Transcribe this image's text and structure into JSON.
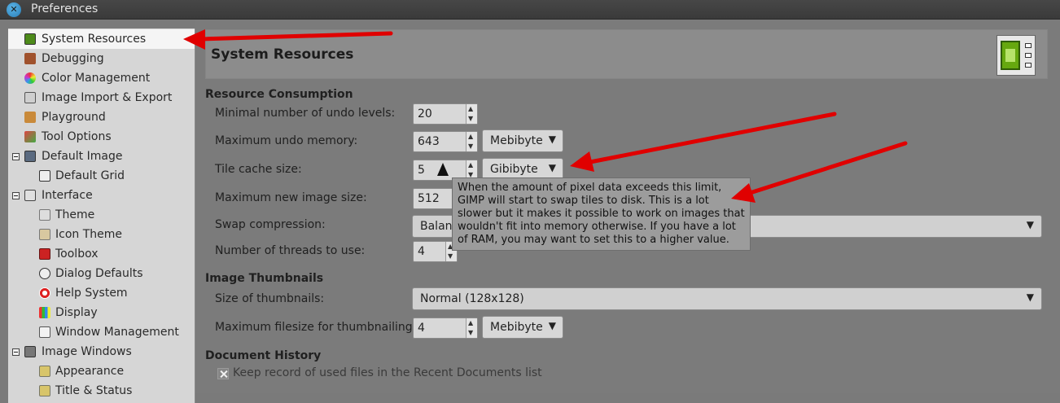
{
  "window": {
    "title": "Preferences"
  },
  "sidebar": {
    "items": [
      {
        "label": "System Resources"
      },
      {
        "label": "Debugging"
      },
      {
        "label": "Color Management"
      },
      {
        "label": "Image Import & Export"
      },
      {
        "label": "Playground"
      },
      {
        "label": "Tool Options"
      },
      {
        "label": "Default Image"
      },
      {
        "label": "Default Grid"
      },
      {
        "label": "Interface"
      },
      {
        "label": "Theme"
      },
      {
        "label": "Icon Theme"
      },
      {
        "label": "Toolbox"
      },
      {
        "label": "Dialog Defaults"
      },
      {
        "label": "Help System"
      },
      {
        "label": "Display"
      },
      {
        "label": "Window Management"
      },
      {
        "label": "Image Windows"
      },
      {
        "label": "Appearance"
      },
      {
        "label": "Title & Status"
      }
    ]
  },
  "page": {
    "title": "System Resources"
  },
  "resource": {
    "section_title": "Resource Consumption",
    "undo_levels": {
      "label": "Minimal number of undo levels:",
      "value": "20"
    },
    "undo_memory": {
      "label": "Maximum undo memory:",
      "value": "643",
      "unit": "Mebibyte"
    },
    "tile_cache": {
      "label": "Tile cache size:",
      "value": "5",
      "unit": "Gibibyte"
    },
    "max_image": {
      "label": "Maximum new image size:",
      "value": "512"
    },
    "swap": {
      "label": "Swap compression:",
      "value": "Balanc"
    },
    "threads": {
      "label": "Number of threads to use:",
      "value": "4"
    }
  },
  "thumbnails": {
    "section_title": "Image Thumbnails",
    "size": {
      "label": "Size of thumbnails:",
      "value": "Normal (128x128)"
    },
    "max_filesize": {
      "label": "Maximum filesize for thumbnailing:",
      "value": "4",
      "unit": "Mebibyte"
    }
  },
  "history": {
    "section_title": "Document History",
    "keep_record": "Keep record of used files in the Recent Documents list"
  },
  "tooltip": {
    "lines": [
      "When the amount of pixel data exceeds this limit,",
      "GIMP will start to swap tiles to disk.  This is a lot",
      "slower but it makes it possible to work on images that",
      "wouldn't fit into memory otherwise.  If you have a lot",
      "of RAM, you may want to set this to a higher value."
    ]
  },
  "icons": {
    "close": "close-icon",
    "system_resources": "memory-chip-icon"
  },
  "colors": {
    "annotation_arrow": "#e00000",
    "close_button": "#3a95d0",
    "chip": "#66a80f"
  }
}
